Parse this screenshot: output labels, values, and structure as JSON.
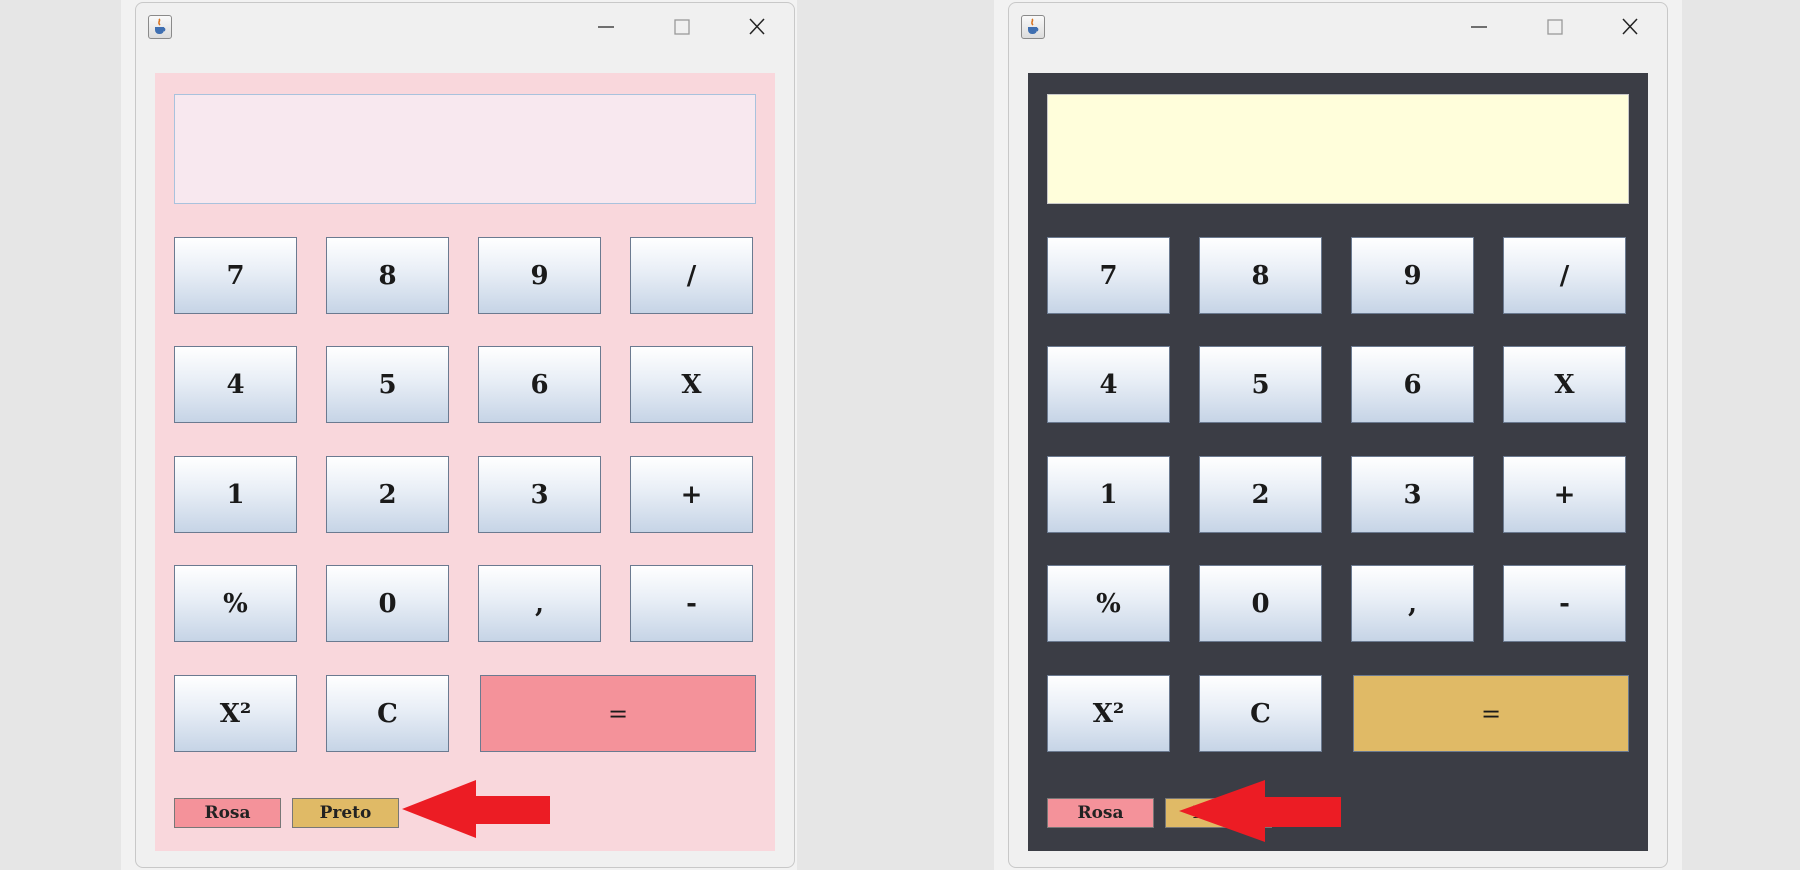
{
  "colors": {
    "pink_panel": "#f9d7dc",
    "pink_display": "#f8e8ef",
    "dark_panel": "#3b3d45",
    "dark_display": "#fffedb",
    "equals_pink": "#f4929a",
    "equals_gold": "#e0ba66",
    "rosa_button": "#f4929a",
    "preto_button": "#e0ba66",
    "arrow_red": "#ec1c24"
  },
  "windows": [
    {
      "theme": "rosa",
      "display_value": "",
      "keys": [
        "7",
        "8",
        "9",
        "/",
        "4",
        "5",
        "6",
        "X",
        "1",
        "2",
        "3",
        "+",
        "%",
        "0",
        ",",
        "-",
        "X²",
        "C"
      ],
      "equals_label": "=",
      "theme_buttons": {
        "rosa_label": "Rosa",
        "preto_label": "Preto"
      }
    },
    {
      "theme": "preto",
      "display_value": "",
      "keys": [
        "7",
        "8",
        "9",
        "/",
        "4",
        "5",
        "6",
        "X",
        "1",
        "2",
        "3",
        "+",
        "%",
        "0",
        ",",
        "-",
        "X²",
        "C"
      ],
      "equals_label": "=",
      "theme_buttons": {
        "rosa_label": "Rosa",
        "preto_label": "Preto"
      }
    }
  ]
}
